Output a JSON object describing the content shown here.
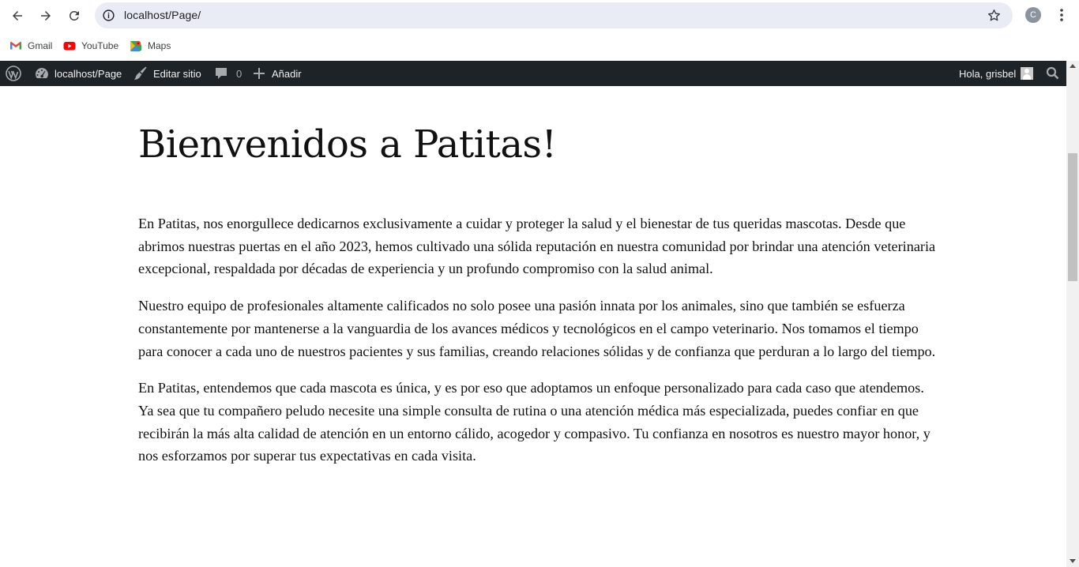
{
  "browser": {
    "url": "localhost/Page/",
    "profile_initial": "C",
    "bookmarks": [
      "Gmail",
      "YouTube",
      "Maps"
    ]
  },
  "adminbar": {
    "site_name": "localhost/Page",
    "edit_site": "Editar sitio",
    "comments_count": "0",
    "add_new": "Añadir",
    "greeting": "Hola, grisbel"
  },
  "page": {
    "title": "Bienvenidos a Patitas!",
    "paragraphs": [
      "En Patitas, nos enorgullece dedicarnos exclusivamente a cuidar y proteger la salud y el bienestar de tus queridas mascotas. Desde que abrimos nuestras puertas en el año 2023, hemos cultivado una sólida reputación en nuestra comunidad por brindar una atención veterinaria excepcional, respaldada por décadas de experiencia y un profundo compromiso con la salud animal.",
      "Nuestro equipo de profesionales altamente calificados no solo posee una pasión innata por los animales, sino que también se esfuerza constantemente por mantenerse a la vanguardia de los avances médicos y tecnológicos en el campo veterinario. Nos tomamos el tiempo para conocer a cada uno de nuestros pacientes y sus familias, creando relaciones sólidas y de confianza que perduran a lo largo del tiempo.",
      "En Patitas, entendemos que cada mascota es única, y es por eso que adoptamos un enfoque personalizado para cada caso que atendemos. Ya sea que tu compañero peludo necesite una simple consulta de rutina o una atención médica más especializada, puedes confiar en que recibirán la más alta calidad de atención en un entorno cálido, acogedor y compasivo. Tu confianza en nosotros es nuestro mayor honor, y nos esforzamos por superar tus expectativas en cada visita."
    ]
  },
  "colors": {
    "adminbar_bg": "#1d2327",
    "omnibox_bg": "#e9ecf5"
  }
}
